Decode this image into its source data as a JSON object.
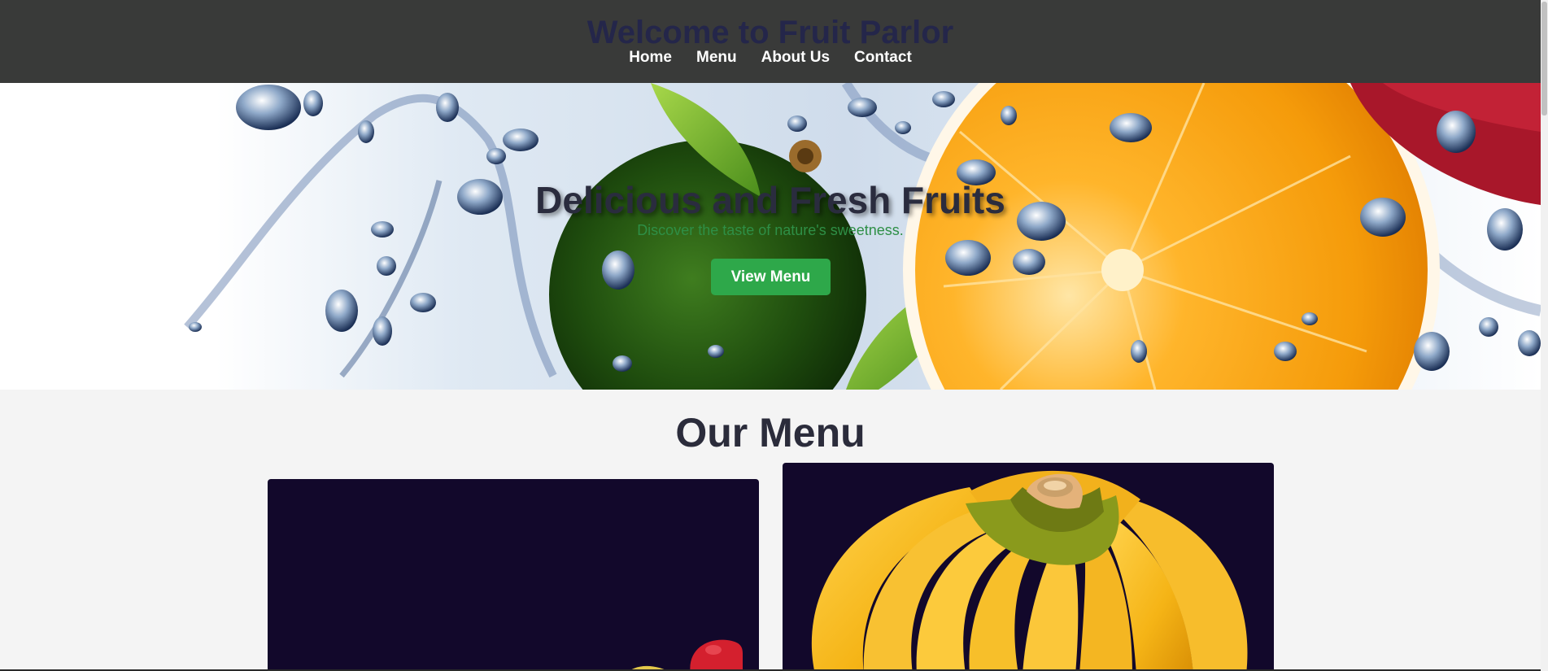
{
  "header": {
    "title": "Welcome to Fruit Parlor",
    "nav": [
      "Home",
      "Menu",
      "About Us",
      "Contact"
    ]
  },
  "hero": {
    "title": "Delicious and Fresh Fruits",
    "subtitle": "Discover the taste of nature's sweetness.",
    "button_label": "View Menu",
    "image": "fruit-splash-image"
  },
  "menu": {
    "heading": "Our Menu",
    "cards": [
      {
        "image": "apple-fruit-image"
      },
      {
        "image": "banana-bunch-image"
      }
    ]
  },
  "colors": {
    "header_bg": "#393a39",
    "accent_green": "#2ea84a",
    "card_bg": "#12082b",
    "page_bg": "#f4f4f4"
  }
}
